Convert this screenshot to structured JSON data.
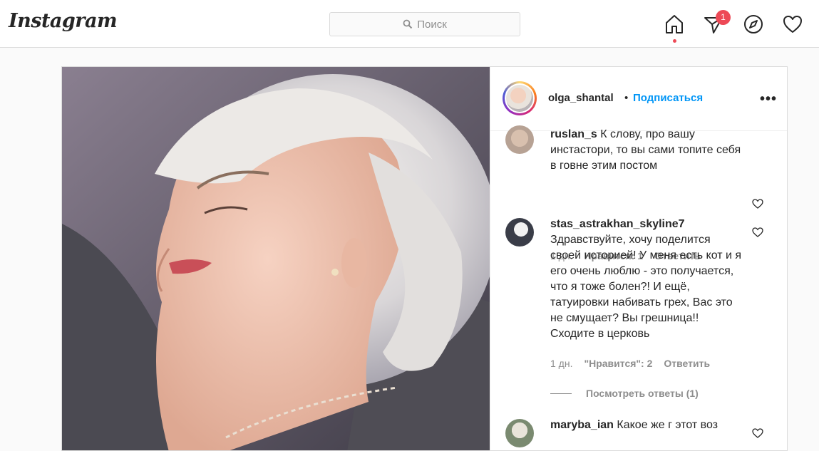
{
  "brand": {
    "logo": "Instagram"
  },
  "search": {
    "placeholder": "Поиск"
  },
  "nav": {
    "icons": [
      "home-icon",
      "direct-icon",
      "explore-icon",
      "activity-icon"
    ],
    "direct_badge": "1"
  },
  "post": {
    "author": "olga_shantal",
    "separator": "•",
    "follow_label": "Подписаться",
    "options": "•••",
    "comments": [
      {
        "username": "ruslan_s",
        "text": "К слову, про вашу инстастори, то вы сами топите себя в говне этим постом",
        "time": "1 дн.",
        "likes": "Нравится: 1",
        "reply": "Ответить"
      },
      {
        "username": "stas_astrakhan_skyline7",
        "text": "Здравствуйте, хочу поделится своей историей! У меня есть кот и я его очень люблю - это получается, что я тоже болен?! И ещё, татуировки набивать грех, Вас это не смущает? Вы грешница!! Сходите в церковь",
        "time": "1 дн.",
        "likes": "\"Нравится\": 2",
        "reply": "Ответить",
        "view_replies": "Посмотреть ответы (1)"
      },
      {
        "username": "maryba_ian",
        "text": "Какое же г этот воз"
      }
    ]
  },
  "colors": {
    "accent": "#0095f6",
    "badge": "#ed4956",
    "muted": "#8e8e8e",
    "border": "#dbdbdb"
  }
}
